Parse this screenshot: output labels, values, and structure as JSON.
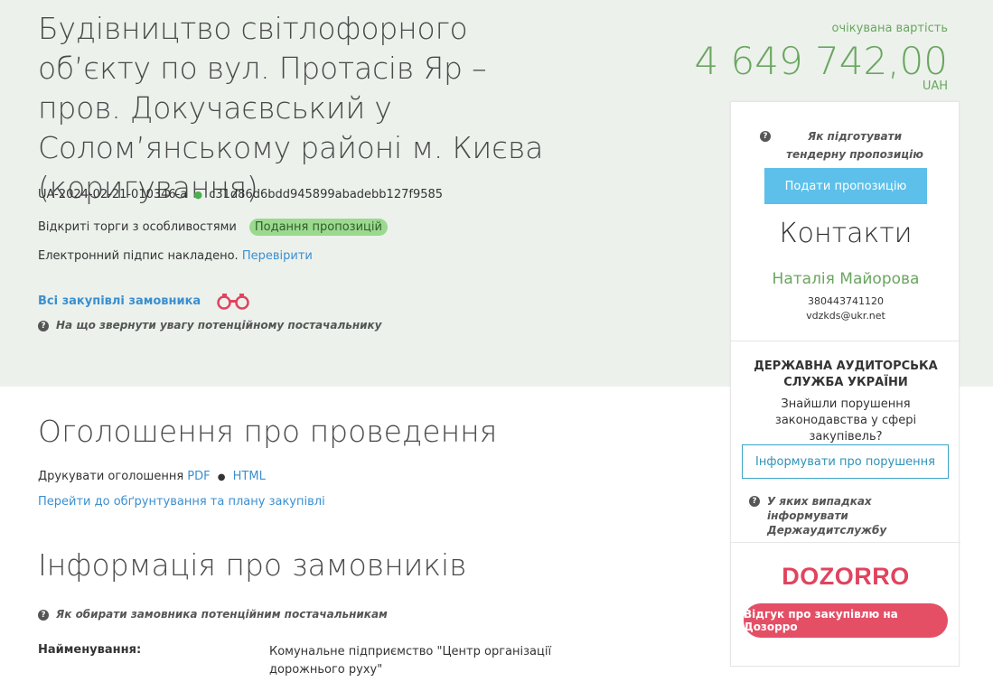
{
  "tender": {
    "title": "Будівництво світлофорного об’єкту по вул. Протасів Яр – пров. Докучаєвський у Солом’янському районі м. Києва (коригування)",
    "id": "UA-2024-02-21-010346-a",
    "hash": "c31d86d6bdd945899abadebb127f9585",
    "procedure_type": "Відкриті торги з особливостями",
    "status": "Подання пропозицій",
    "signature_text": "Електронний підпис накладено.",
    "signature_link": "Перевірити",
    "buyer_link": "Всі закупівлі замовника",
    "supplier_hint": "На що звернути увагу потенційному постачальнику"
  },
  "price": {
    "label": "очікувана вартість",
    "value": "4 649 742,00",
    "currency": "UAH"
  },
  "sidebar": {
    "prepare_hint": "Як підготувати тендерну пропозицію",
    "submit_bid": "Подати пропозицію",
    "contacts_title": "Контакти",
    "contact_name": "Наталія Майорова",
    "contact_phone": "380443741120",
    "contact_email": "vdzkds@ukr.net",
    "audit_title": "ДЕРЖАВНА АУДИТОРСЬКА СЛУЖБА УКРАЇНИ",
    "audit_question": "Знайшли порушення законодавства у сфері закупівель?",
    "inform_button": "Інформувати про порушення",
    "audit_hint": "У яких випадках інформувати Держаудитслужбу",
    "dozorro_logo": "DOZORRO",
    "dozorro_button": "Відгук про закупівлю на Дозорро"
  },
  "announcement": {
    "title": "Оголошення про проведення",
    "print_label": "Друкувати оголошення",
    "pdf": "PDF",
    "html": "HTML",
    "plan_link": "Перейти до обґрунтування та плану закупівлі"
  },
  "buyers": {
    "title": "Інформація про замовників",
    "hint": "Як обирати замовника потенційним постачальникам",
    "name_label": "Найменування:",
    "name_value": "Комунальне підприємство \"Центр організації дорожнього руху\""
  },
  "colors": {
    "accent_green": "#6aa65f",
    "link_blue": "#3a8fd0",
    "bid_button": "#5cc0ea",
    "dozorro_red": "#e44f66"
  },
  "icons": {
    "question": "question-circle-icon",
    "binoculars": "binoculars-icon"
  }
}
